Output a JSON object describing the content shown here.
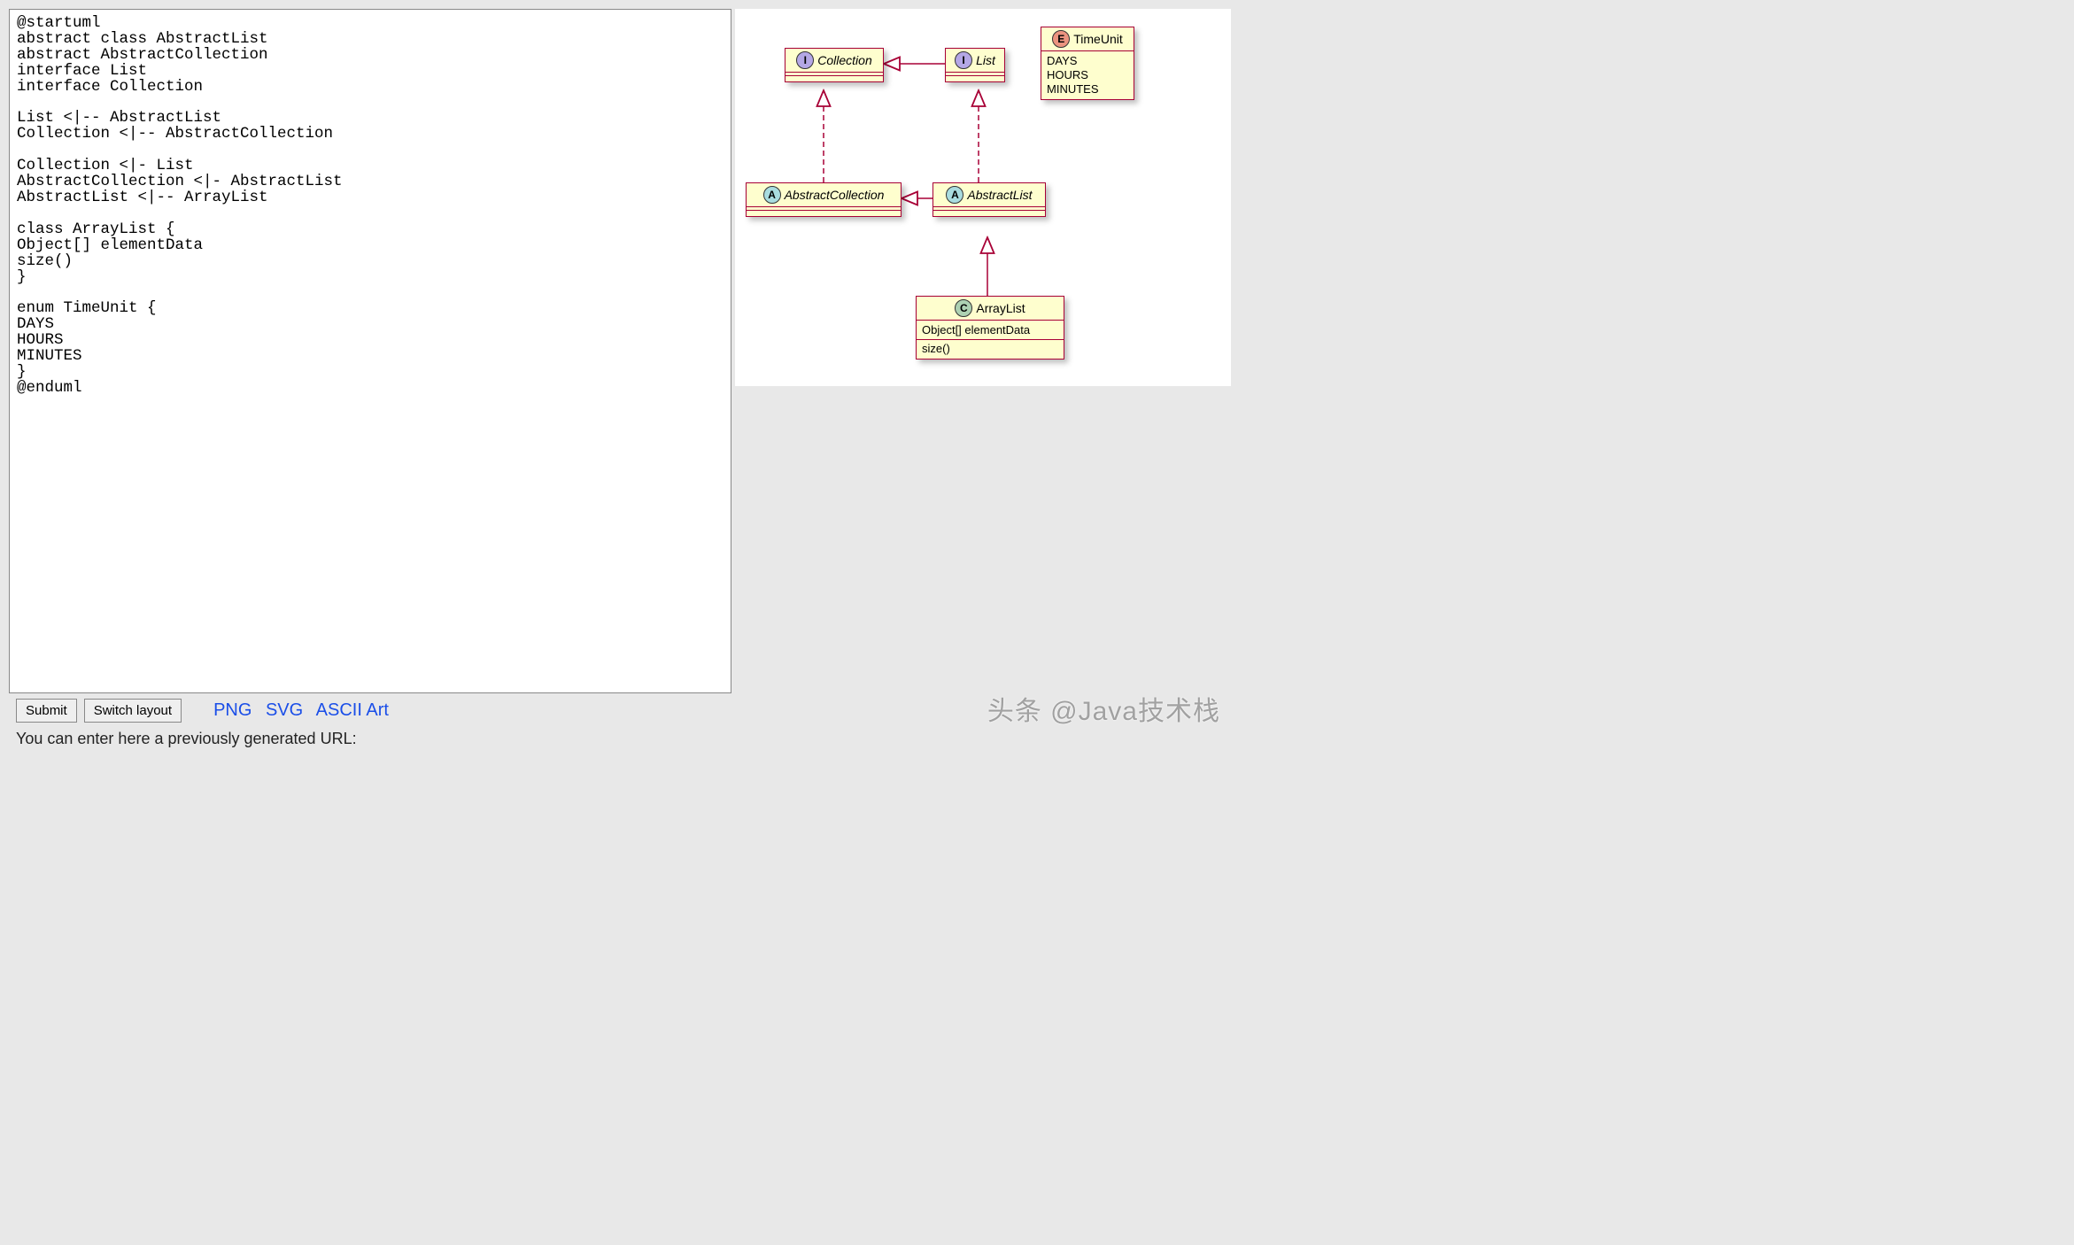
{
  "editor_code": "@startuml\nabstract class AbstractList\nabstract AbstractCollection\ninterface List\ninterface Collection\n\nList <|-- AbstractList\nCollection <|-- AbstractCollection\n\nCollection <|- List\nAbstractCollection <|- AbstractList\nAbstractList <|-- ArrayList\n\nclass ArrayList {\nObject[] elementData\nsize()\n}\n\nenum TimeUnit {\nDAYS\nHOURS\nMINUTES\n}\n@enduml",
  "buttons": {
    "submit": "Submit",
    "switch_layout": "Switch layout"
  },
  "format_links": {
    "png": "PNG",
    "svg": "SVG",
    "ascii": "ASCII Art"
  },
  "hint_text": "You can enter here a previously generated URL:",
  "watermark": "头条 @Java技术栈",
  "uml": {
    "collection": {
      "badge": "I",
      "name": "Collection"
    },
    "list": {
      "badge": "I",
      "name": "List"
    },
    "timeunit": {
      "badge": "E",
      "name": "TimeUnit",
      "items": [
        "DAYS",
        "HOURS",
        "MINUTES"
      ]
    },
    "abstract_collection": {
      "badge": "A",
      "name": "AbstractCollection"
    },
    "abstract_list": {
      "badge": "A",
      "name": "AbstractList"
    },
    "arraylist": {
      "badge": "C",
      "name": "ArrayList",
      "field": "Object[] elementData",
      "method": "size()"
    }
  }
}
